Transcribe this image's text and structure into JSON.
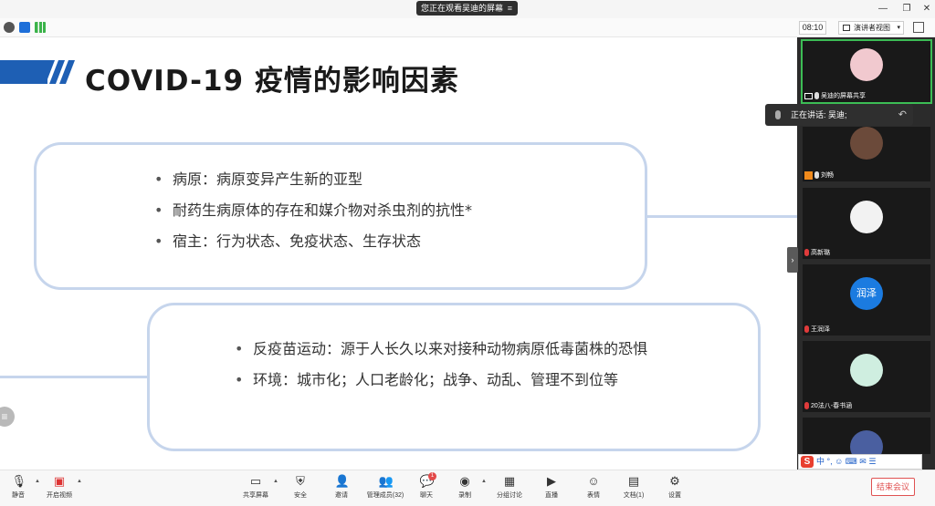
{
  "titlebar": {
    "view_notice": "您正在观看吴迪的屏幕"
  },
  "subbar": {
    "timer": "08:10",
    "speaker_view": "演讲者视图"
  },
  "slide": {
    "title": "COVID-19 疫情的影响因素",
    "box1": [
      "病原：病原变异产生新的亚型",
      "耐药生病原体的存在和媒介物对杀虫剂的抗性*",
      "宿主：行为状态、免疫状态、生存状态"
    ],
    "box2": [
      "反疫苗运动：源于人长久以来对接种动物病原低毒菌株的恐惧",
      "环境：城市化；人口老龄化；战争、动乱、管理不到位等"
    ],
    "accent_color": "#1e5fb4",
    "box_border_color": "#c6d5ec"
  },
  "gallery": {
    "speaking_label": "正在讲话: 吴迪;",
    "tiles": [
      {
        "name": "吴迪的屏幕共享",
        "avatar": ""
      },
      {
        "name": "刘畅",
        "avatar": ""
      },
      {
        "name": "高新璐",
        "avatar": ""
      },
      {
        "name": "王润泽",
        "avatar": "润泽"
      },
      {
        "name": "20法八-春书涵",
        "avatar": ""
      },
      {
        "name": "",
        "avatar": ""
      }
    ]
  },
  "ime": {
    "logo": "S",
    "lang": "中"
  },
  "toolbar": {
    "mute": "静音",
    "video": "开启视频",
    "share": "共享屏幕",
    "security": "安全",
    "invite": "邀请",
    "members": "管理成员(32)",
    "chat": "聊天",
    "chat_badge": "1",
    "record": "录制",
    "breakout": "分组讨论",
    "live": "直播",
    "reactions": "表情",
    "docs": "文档(1)",
    "settings": "设置",
    "end": "结束会议"
  }
}
